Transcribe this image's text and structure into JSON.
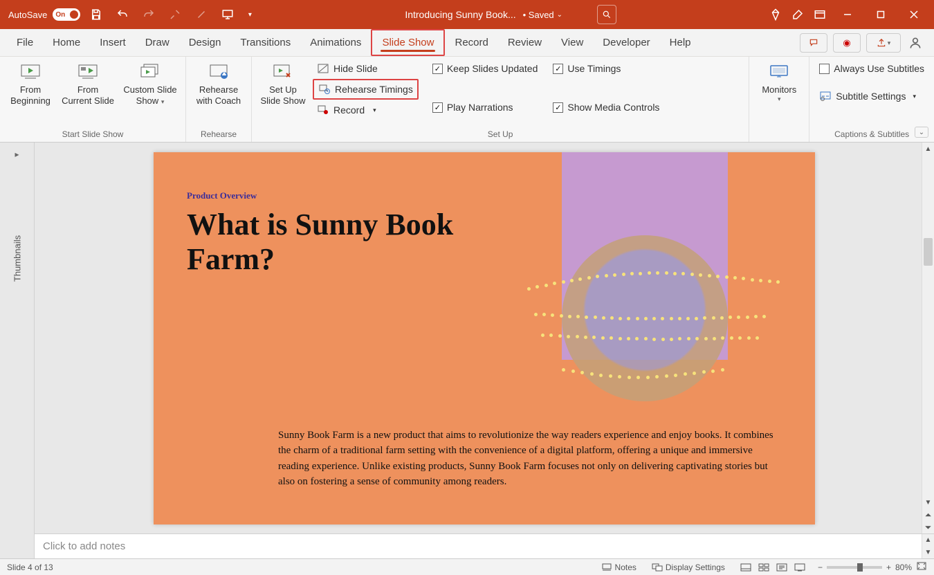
{
  "titlebar": {
    "autosave_label": "AutoSave",
    "autosave_state": "On",
    "doc_title": "Introducing Sunny Book...",
    "saved_label": "• Saved"
  },
  "tabs": {
    "file": "File",
    "home": "Home",
    "insert": "Insert",
    "draw": "Draw",
    "design": "Design",
    "transitions": "Transitions",
    "animations": "Animations",
    "slideshow": "Slide Show",
    "record": "Record",
    "review": "Review",
    "view": "View",
    "developer": "Developer",
    "help": "Help"
  },
  "ribbon": {
    "group_start": "Start Slide Show",
    "group_rehearse": "Rehearse",
    "group_setup": "Set Up",
    "group_captions": "Captions & Subtitles",
    "from_beginning_l1": "From",
    "from_beginning_l2": "Beginning",
    "from_current_l1": "From",
    "from_current_l2": "Current Slide",
    "custom_l1": "Custom Slide",
    "custom_l2": "Show",
    "rehearse_coach_l1": "Rehearse",
    "rehearse_coach_l2": "with Coach",
    "setup_l1": "Set Up",
    "setup_l2": "Slide Show",
    "hide_slide": "Hide Slide",
    "rehearse_timings": "Rehearse Timings",
    "record_label": "Record",
    "keep_updated": "Keep Slides Updated",
    "play_narrations": "Play Narrations",
    "use_timings": "Use Timings",
    "show_media": "Show Media Controls",
    "monitors": "Monitors",
    "always_subtitles": "Always Use Subtitles",
    "subtitle_settings": "Subtitle Settings"
  },
  "thumbnails": {
    "label": "Thumbnails"
  },
  "slide": {
    "eyebrow": "Product Overview",
    "headline": "What is Sunny Book Farm?",
    "body": "Sunny Book Farm is a new product that aims to revolutionize the way readers experience and enjoy books. It combines the charm of a traditional farm setting with the convenience of a digital platform, offering a unique and immersive reading experience. Unlike existing products, Sunny Book Farm focuses not only on delivering captivating stories but also on fostering a sense of community among readers."
  },
  "notes": {
    "placeholder": "Click to add notes"
  },
  "status": {
    "slide_info": "Slide 4 of 13",
    "notes_btn": "Notes",
    "display_btn": "Display Settings",
    "zoom_pct": "80%"
  }
}
